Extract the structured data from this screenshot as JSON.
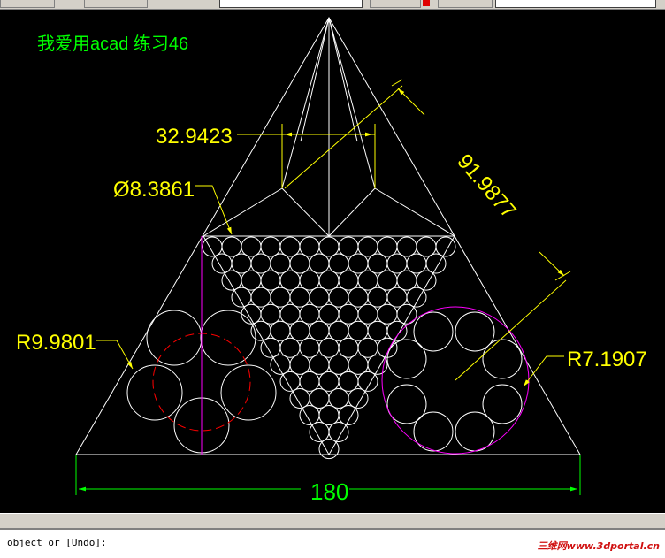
{
  "drawing": {
    "title": "我爱用acad 练习46",
    "dimensions": {
      "top_width": "32.9423",
      "circle_diameter": "Ø8.3861",
      "slant_length": "91.9877",
      "left_radius": "R9.9801",
      "right_radius": "R7.1907",
      "base_width": "180"
    }
  },
  "colors": {
    "background": "#000000",
    "geometry": "#ffffff",
    "dimension": "#ffff00",
    "title": "#00ff00",
    "magenta": "#ff00ff",
    "red": "#ff0000",
    "base_dim": "#00ff00"
  },
  "command_line": {
    "prompt": "object or [Undo]:"
  },
  "watermark": "三维网www.3dportal.cn"
}
